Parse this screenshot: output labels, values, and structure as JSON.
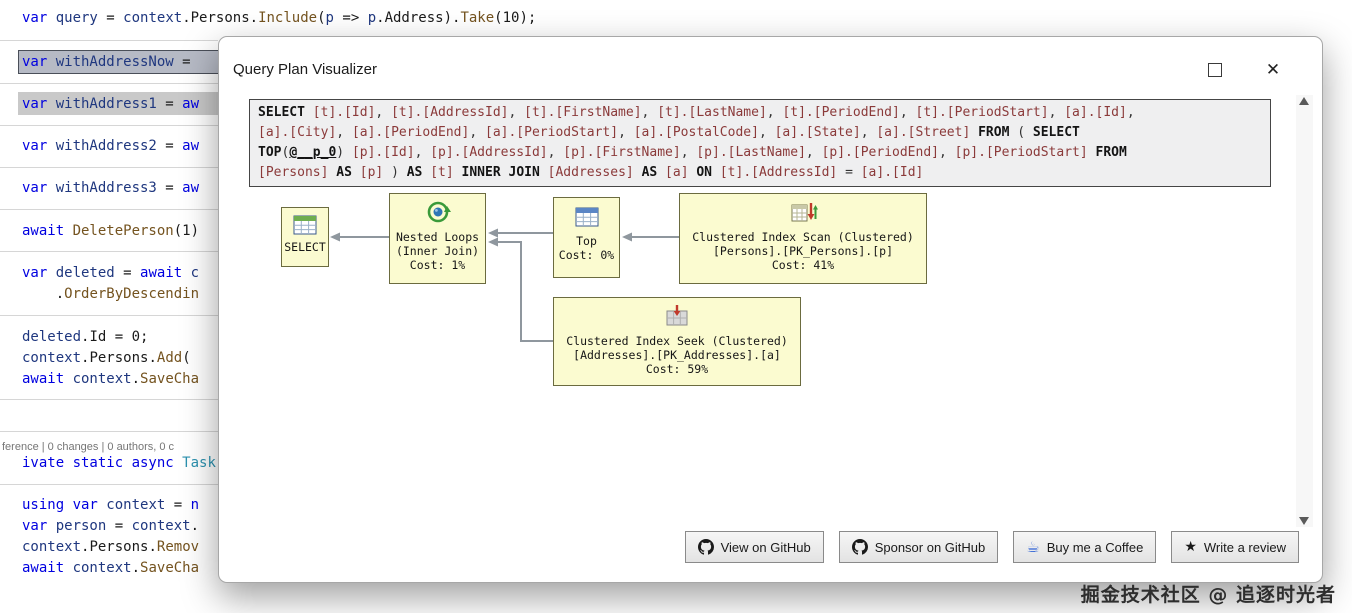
{
  "editor": {
    "lines": [
      {
        "name": "code-line-query",
        "tokens": [
          {
            "t": "var ",
            "c": "kw"
          },
          {
            "t": "query",
            "c": "id"
          },
          {
            "t": " = ",
            "c": "pl"
          },
          {
            "t": "context",
            "c": "id"
          },
          {
            "t": ".",
            "c": "pl"
          },
          {
            "t": "Persons",
            "c": "pl"
          },
          {
            "t": ".",
            "c": "pl"
          },
          {
            "t": "Include",
            "c": "m"
          },
          {
            "t": "(",
            "c": "pl"
          },
          {
            "t": "p",
            "c": "id"
          },
          {
            "t": " => ",
            "c": "pl"
          },
          {
            "t": "p",
            "c": "id"
          },
          {
            "t": ".",
            "c": "pl"
          },
          {
            "t": "Address",
            "c": "pl"
          },
          {
            "t": ")",
            "c": "pl"
          },
          {
            "t": ".",
            "c": "pl"
          },
          {
            "t": "Take",
            "c": "m"
          },
          {
            "t": "(",
            "c": "pl"
          },
          {
            "t": "10",
            "c": "pl"
          },
          {
            "t": ");",
            "c": "pl"
          }
        ]
      },
      {
        "name": "code-line-withAddressNow",
        "highlight": "active",
        "tokens": [
          {
            "t": "var ",
            "c": "kw"
          },
          {
            "t": "withAddressNow",
            "c": "id"
          },
          {
            "t": " = ",
            "c": "pl"
          }
        ]
      },
      {
        "name": "code-line-withAddress1",
        "highlight": "match",
        "tokens": [
          {
            "t": "var ",
            "c": "kw"
          },
          {
            "t": "withAddress1",
            "c": "id"
          },
          {
            "t": " = ",
            "c": "pl"
          },
          {
            "t": "aw",
            "c": "kw"
          }
        ]
      },
      {
        "name": "code-line-withAddress2",
        "tokens": [
          {
            "t": "var ",
            "c": "kw"
          },
          {
            "t": "withAddress2",
            "c": "id"
          },
          {
            "t": " = ",
            "c": "pl"
          },
          {
            "t": "aw",
            "c": "kw"
          }
        ]
      },
      {
        "name": "code-line-withAddress3",
        "tokens": [
          {
            "t": "var ",
            "c": "kw"
          },
          {
            "t": "withAddress3",
            "c": "id"
          },
          {
            "t": " = ",
            "c": "pl"
          },
          {
            "t": "aw",
            "c": "kw"
          }
        ]
      },
      {
        "name": "code-line-deleteperson",
        "tokens": [
          {
            "t": "await ",
            "c": "kw"
          },
          {
            "t": "DeletePerson",
            "c": "m"
          },
          {
            "t": "(",
            "c": "pl"
          },
          {
            "t": "1",
            "c": "pl"
          },
          {
            "t": ")",
            "c": "pl"
          }
        ]
      },
      {
        "name": "code-line-deleted",
        "tokens": [
          {
            "t": "var ",
            "c": "kw"
          },
          {
            "t": "deleted",
            "c": "id"
          },
          {
            "t": " = ",
            "c": "pl"
          },
          {
            "t": "await ",
            "c": "kw"
          },
          {
            "t": "c",
            "c": "id"
          }
        ]
      },
      {
        "name": "code-line-orderby",
        "tokens": [
          {
            "t": "    .",
            "c": "pl"
          },
          {
            "t": "OrderByDescendin",
            "c": "m"
          }
        ]
      },
      {
        "name": "code-line-deleted-id",
        "tokens": [
          {
            "t": "deleted",
            "c": "id"
          },
          {
            "t": ".",
            "c": "pl"
          },
          {
            "t": "Id",
            "c": "pl"
          },
          {
            "t": " = ",
            "c": "pl"
          },
          {
            "t": "0",
            "c": "pl"
          },
          {
            "t": ";",
            "c": "pl"
          }
        ]
      },
      {
        "name": "code-line-persons-add",
        "tokens": [
          {
            "t": "context",
            "c": "id"
          },
          {
            "t": ".",
            "c": "pl"
          },
          {
            "t": "Persons",
            "c": "pl"
          },
          {
            "t": ".",
            "c": "pl"
          },
          {
            "t": "Add",
            "c": "m"
          },
          {
            "t": "(",
            "c": "pl"
          }
        ]
      },
      {
        "name": "code-line-savechanges-1",
        "tokens": [
          {
            "t": "await ",
            "c": "kw"
          },
          {
            "t": "context",
            "c": "id"
          },
          {
            "t": ".",
            "c": "pl"
          },
          {
            "t": "SaveCha",
            "c": "m"
          }
        ]
      },
      {
        "name": "codelens-line",
        "kind": "codelens",
        "tokens": [
          {
            "t": "ference | 0 changes | 0 authors, 0 c",
            "c": "cl"
          }
        ]
      },
      {
        "name": "code-line-method-signature",
        "tokens": [
          {
            "t": "ivate static async ",
            "c": "kw"
          },
          {
            "t": "Task",
            "c": "ty"
          }
        ]
      },
      {
        "name": "code-line-using-context",
        "tokens": [
          {
            "t": "using ",
            "c": "kw"
          },
          {
            "t": "var ",
            "c": "kw"
          },
          {
            "t": "context",
            "c": "id"
          },
          {
            "t": " = ",
            "c": "pl"
          },
          {
            "t": "n",
            "c": "kw"
          }
        ]
      },
      {
        "name": "code-line-person",
        "tokens": [
          {
            "t": "var ",
            "c": "kw"
          },
          {
            "t": "person",
            "c": "id"
          },
          {
            "t": " = ",
            "c": "pl"
          },
          {
            "t": "context",
            "c": "id"
          },
          {
            "t": ".",
            "c": "pl"
          }
        ]
      },
      {
        "name": "code-line-persons-remove",
        "tokens": [
          {
            "t": "context",
            "c": "id"
          },
          {
            "t": ".",
            "c": "pl"
          },
          {
            "t": "Persons",
            "c": "pl"
          },
          {
            "t": ".",
            "c": "pl"
          },
          {
            "t": "Remov",
            "c": "m"
          }
        ]
      },
      {
        "name": "code-line-savechanges-2",
        "tokens": [
          {
            "t": "await ",
            "c": "kw"
          },
          {
            "t": "context",
            "c": "id"
          },
          {
            "t": ".",
            "c": "pl"
          },
          {
            "t": "SaveCha",
            "c": "m"
          }
        ]
      }
    ]
  },
  "dialog": {
    "title": "Query Plan Visualizer",
    "controls": {
      "close": "✕"
    },
    "sql_lines": [
      [
        {
          "t": "SELECT ",
          "c": "k"
        },
        {
          "t": "[t].[Id]",
          "c": "i"
        },
        {
          "t": ", ",
          "c": "p"
        },
        {
          "t": "[t].[AddressId]",
          "c": "i"
        },
        {
          "t": ", ",
          "c": "p"
        },
        {
          "t": "[t].[FirstName]",
          "c": "i"
        },
        {
          "t": ", ",
          "c": "p"
        },
        {
          "t": "[t].[LastName]",
          "c": "i"
        },
        {
          "t": ", ",
          "c": "p"
        },
        {
          "t": "[t].[PeriodEnd]",
          "c": "i"
        },
        {
          "t": ", ",
          "c": "p"
        },
        {
          "t": "[t].[PeriodStart]",
          "c": "i"
        },
        {
          "t": ", ",
          "c": "p"
        },
        {
          "t": "[a].[Id]",
          "c": "i"
        },
        {
          "t": ",",
          "c": "p"
        }
      ],
      [
        {
          "t": "[a].[City]",
          "c": "i"
        },
        {
          "t": ", ",
          "c": "p"
        },
        {
          "t": "[a].[PeriodEnd]",
          "c": "i"
        },
        {
          "t": ", ",
          "c": "p"
        },
        {
          "t": "[a].[PeriodStart]",
          "c": "i"
        },
        {
          "t": ", ",
          "c": "p"
        },
        {
          "t": "[a].[PostalCode]",
          "c": "i"
        },
        {
          "t": ", ",
          "c": "p"
        },
        {
          "t": "[a].[State]",
          "c": "i"
        },
        {
          "t": ", ",
          "c": "p"
        },
        {
          "t": "[a].[Street]",
          "c": "i"
        },
        {
          "t": " ",
          "c": "p"
        },
        {
          "t": "FROM",
          "c": "k"
        },
        {
          "t": " ( ",
          "c": "p"
        },
        {
          "t": "SELECT",
          "c": "k"
        }
      ],
      [
        {
          "t": "TOP",
          "c": "k"
        },
        {
          "t": "(",
          "c": "p"
        },
        {
          "t": "@__p_0",
          "c": "v"
        },
        {
          "t": ") ",
          "c": "p"
        },
        {
          "t": "[p].[Id]",
          "c": "i"
        },
        {
          "t": ", ",
          "c": "p"
        },
        {
          "t": "[p].[AddressId]",
          "c": "i"
        },
        {
          "t": ", ",
          "c": "p"
        },
        {
          "t": "[p].[FirstName]",
          "c": "i"
        },
        {
          "t": ", ",
          "c": "p"
        },
        {
          "t": "[p].[LastName]",
          "c": "i"
        },
        {
          "t": ", ",
          "c": "p"
        },
        {
          "t": "[p].[PeriodEnd]",
          "c": "i"
        },
        {
          "t": ", ",
          "c": "p"
        },
        {
          "t": "[p].[PeriodStart]",
          "c": "i"
        },
        {
          "t": " ",
          "c": "p"
        },
        {
          "t": "FROM",
          "c": "k"
        }
      ],
      [
        {
          "t": "[Persons]",
          "c": "i"
        },
        {
          "t": " ",
          "c": "p"
        },
        {
          "t": "AS",
          "c": "k"
        },
        {
          "t": " ",
          "c": "p"
        },
        {
          "t": "[p]",
          "c": "i"
        },
        {
          "t": " ) ",
          "c": "p"
        },
        {
          "t": "AS",
          "c": "k"
        },
        {
          "t": " ",
          "c": "p"
        },
        {
          "t": "[t]",
          "c": "i"
        },
        {
          "t": " ",
          "c": "p"
        },
        {
          "t": "INNER JOIN",
          "c": "k"
        },
        {
          "t": " ",
          "c": "p"
        },
        {
          "t": "[Addresses]",
          "c": "i"
        },
        {
          "t": " ",
          "c": "p"
        },
        {
          "t": "AS",
          "c": "k"
        },
        {
          "t": " ",
          "c": "p"
        },
        {
          "t": "[a]",
          "c": "i"
        },
        {
          "t": " ",
          "c": "p"
        },
        {
          "t": "ON",
          "c": "k"
        },
        {
          "t": " ",
          "c": "p"
        },
        {
          "t": "[t].[AddressId]",
          "c": "i"
        },
        {
          "t": " = ",
          "c": "p"
        },
        {
          "t": "[a].[Id]",
          "c": "i"
        }
      ]
    ],
    "plan": {
      "nodes": {
        "select": {
          "lines": [
            "SELECT"
          ]
        },
        "nested": {
          "lines": [
            "Nested Loops",
            "(Inner Join)",
            "Cost: 1%"
          ]
        },
        "top": {
          "lines": [
            "Top",
            "Cost: 0%"
          ]
        },
        "scan": {
          "lines": [
            "Clustered Index Scan (Clustered)",
            "[Persons].[PK_Persons].[p]",
            "Cost: 41%"
          ]
        },
        "seek": {
          "lines": [
            "Clustered Index Seek (Clustered)",
            "[Addresses].[PK_Addresses].[a]",
            "Cost: 59%"
          ]
        }
      }
    },
    "buttons": [
      {
        "label": "View on GitHub",
        "icon": "github-icon"
      },
      {
        "label": "Sponsor on GitHub",
        "icon": "github-icon"
      },
      {
        "label": "Buy me a Coffee",
        "icon": "coffee-icon"
      },
      {
        "label": "Write a review",
        "icon": "star-icon"
      }
    ]
  },
  "icons": {
    "coffee": "☕",
    "star": "★"
  },
  "watermark": "掘金技术社区 @ 追逐时光者",
  "colors": {
    "node_fill": "#fbfbd0",
    "node_border": "#6b6b3f",
    "keyword_blue": "#0000e0",
    "sql_identifier": "#8b3a3a",
    "highlight_active": "#b6bac5",
    "highlight_match": "#c9c9c9"
  }
}
